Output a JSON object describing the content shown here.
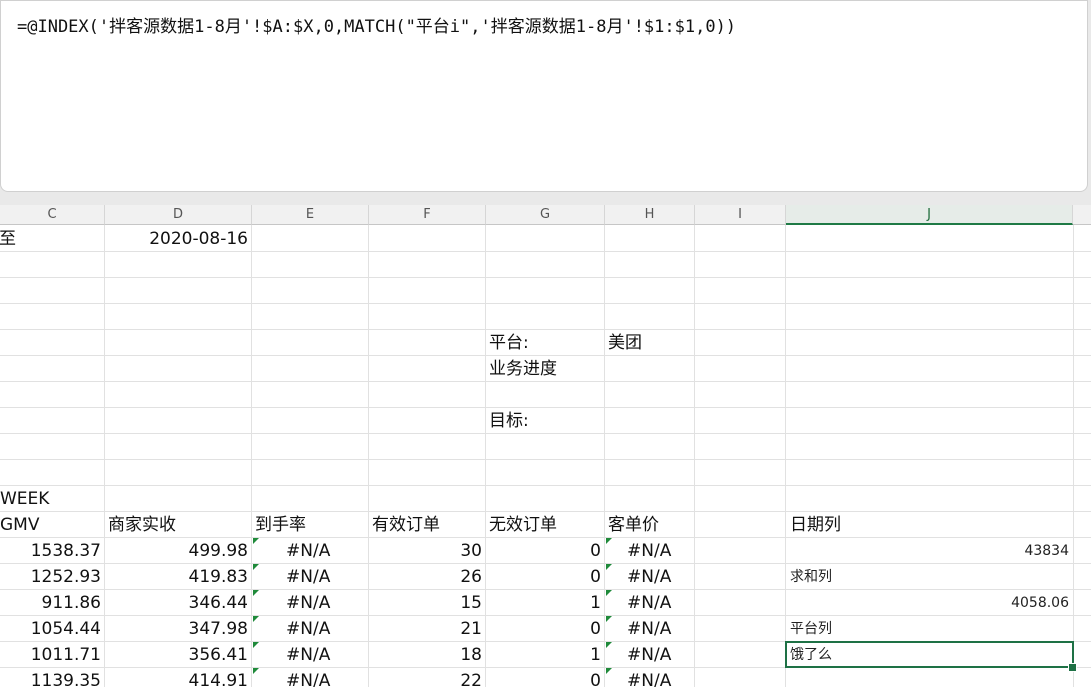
{
  "formula_bar": {
    "text": "=@INDEX('拌客源数据1-8月'!$A:$X,0,MATCH(\"平台i\",'拌客源数据1-8月'!$1:$1,0))"
  },
  "columns": [
    "C",
    "D",
    "E",
    "F",
    "G",
    "H",
    "I",
    "J"
  ],
  "active_column": "J",
  "cells": {
    "c_to": "至",
    "date": "2020-08-16",
    "platform_label": "平台:",
    "platform_value": "美团",
    "progress_label": "业务进度",
    "target_label": "目标:",
    "week_label": "WEEK"
  },
  "table": {
    "headers": [
      "GMV",
      "商家实收",
      "到手率",
      "有效订单",
      "无效订单",
      "客单价"
    ],
    "rows": [
      [
        "1538.37",
        "499.98",
        "#N/A",
        "30",
        "0",
        "#N/A"
      ],
      [
        "1252.93",
        "419.83",
        "#N/A",
        "26",
        "0",
        "#N/A"
      ],
      [
        "911.86",
        "346.44",
        "#N/A",
        "15",
        "1",
        "#N/A"
      ],
      [
        "1054.44",
        "347.98",
        "#N/A",
        "21",
        "0",
        "#N/A"
      ],
      [
        "1011.71",
        "356.41",
        "#N/A",
        "18",
        "1",
        "#N/A"
      ],
      [
        "1139.35",
        "414.91",
        "#N/A",
        "22",
        "0",
        "#N/A"
      ]
    ]
  },
  "side_panel": {
    "date_col_label": "日期列",
    "date_col_value": "43834",
    "sum_col_label": "求和列",
    "sum_col_value": "4058.06",
    "platform_col_label": "平台列",
    "platform_col_value": "饿了么"
  },
  "colors": {
    "selection": "#1e7145",
    "error_indicator": "#1f8a3a"
  }
}
